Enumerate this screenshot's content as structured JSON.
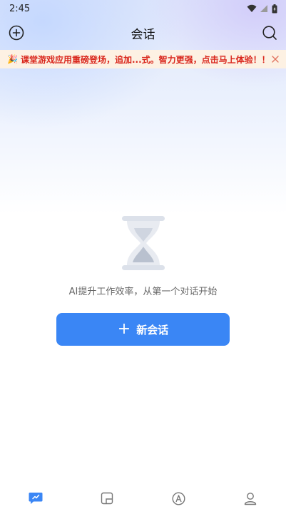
{
  "status_bar": {
    "time": "2:45"
  },
  "header": {
    "title": "会话",
    "add_icon": "plus-circle-icon",
    "search_icon": "search-icon"
  },
  "banner": {
    "emoji": "🎉",
    "text": "课堂游戏应用重磅登场，追加...式。智力更强，点击马上体验！！",
    "close_icon": "close-icon"
  },
  "empty_state": {
    "icon": "hourglass-icon",
    "text": "AI提升工作效率，从第一个对话开始"
  },
  "new_chat_button": {
    "plus": "+",
    "label": "新会话"
  },
  "tabbar": {
    "tabs": [
      {
        "icon": "chat-icon",
        "active": true
      },
      {
        "icon": "square-icon",
        "active": false
      },
      {
        "icon": "compass-icon",
        "active": false
      },
      {
        "icon": "profile-icon",
        "active": false
      }
    ]
  },
  "colors": {
    "accent": "#3a86f5",
    "banner_bg": "#fdf1e3",
    "banner_text": "#d9261c"
  }
}
